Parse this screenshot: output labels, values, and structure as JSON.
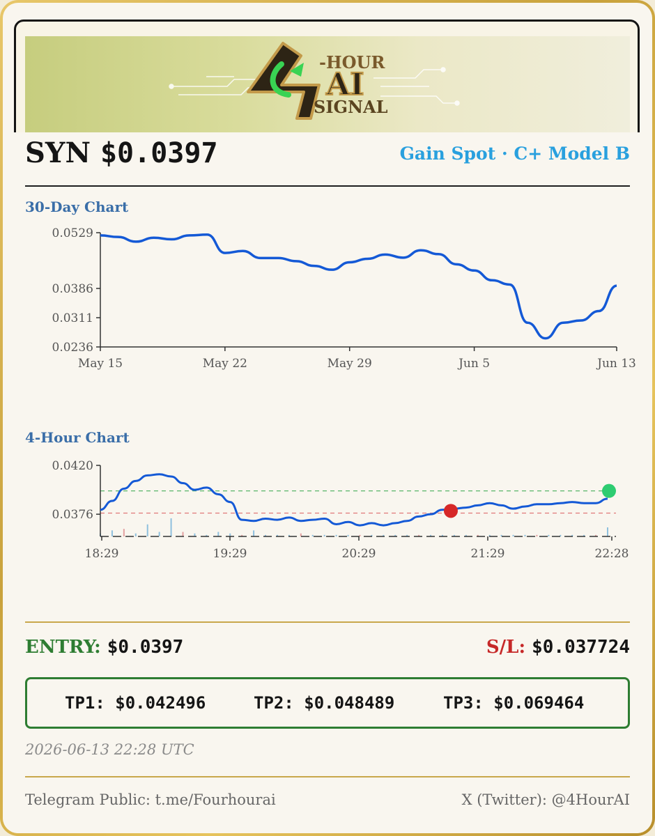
{
  "header": {
    "symbol": "SYN",
    "price": "$0.0397",
    "model": "Gain Spot · C+ Model B"
  },
  "logo": {
    "line1": "-HOUR",
    "line2": "AI",
    "line3": "SIGNAL",
    "numeral": "4"
  },
  "colors": {
    "line": "#1459d6",
    "tp_line": "#5ab56a",
    "sl_line": "#e07878",
    "entry_dot": "#d62828",
    "target_dot": "#2ecc71",
    "gold": "#c9a74b"
  },
  "chart_data": [
    {
      "type": "line",
      "title": "30-Day Chart",
      "x": [
        "May 15",
        "May 16",
        "May 17",
        "May 18",
        "May 19",
        "May 20",
        "May 21",
        "May 22",
        "May 23",
        "May 24",
        "May 25",
        "May 26",
        "May 27",
        "May 28",
        "May 29",
        "May 30",
        "May 31",
        "Jun 1",
        "Jun 2",
        "Jun 3",
        "Jun 4",
        "Jun 5",
        "Jun 6",
        "Jun 7",
        "Jun 8",
        "Jun 9",
        "Jun 10",
        "Jun 11",
        "Jun 12",
        "Jun 13"
      ],
      "y": [
        0.0522,
        0.0518,
        0.0506,
        0.0516,
        0.0512,
        0.0522,
        0.0524,
        0.0477,
        0.0482,
        0.0464,
        0.0464,
        0.0456,
        0.0444,
        0.0434,
        0.0453,
        0.0462,
        0.0473,
        0.0465,
        0.0484,
        0.0474,
        0.0448,
        0.0432,
        0.0407,
        0.0396,
        0.0298,
        0.0258,
        0.0298,
        0.0304,
        0.0328,
        0.0393
      ],
      "ylim": [
        0.0236,
        0.0529
      ],
      "yticks": [
        "0.0529",
        "0.0386",
        "0.0311",
        "0.0236"
      ],
      "xticks": [
        "May 15",
        "May 22",
        "May 29",
        "Jun 5",
        "Jun 13"
      ]
    },
    {
      "type": "line",
      "title": "4-Hour Chart",
      "x_start": "18:29",
      "x_end": "22:28",
      "y": [
        0.038,
        0.0388,
        0.0399,
        0.0406,
        0.0411,
        0.0412,
        0.041,
        0.0404,
        0.0398,
        0.04,
        0.0394,
        0.0387,
        0.0371,
        0.037,
        0.0372,
        0.0371,
        0.0373,
        0.037,
        0.0371,
        0.0372,
        0.0367,
        0.0369,
        0.0366,
        0.0368,
        0.0366,
        0.0368,
        0.037,
        0.0374,
        0.0376,
        0.038,
        0.0381,
        0.0382,
        0.0384,
        0.0386,
        0.0384,
        0.0381,
        0.0383,
        0.0385,
        0.0385,
        0.0386,
        0.0387,
        0.0386,
        0.0386,
        0.039
      ],
      "volume": [
        2,
        4,
        5,
        2,
        8,
        3,
        12,
        3,
        2,
        1,
        3,
        2,
        1,
        4,
        1,
        1,
        1,
        2,
        1,
        1,
        1,
        1,
        1,
        1,
        1,
        1,
        1,
        1,
        1,
        1,
        1,
        1,
        1,
        1,
        1,
        1,
        1,
        1,
        1,
        1,
        1,
        1,
        1,
        6
      ],
      "ylim": [
        0.0356,
        0.042
      ],
      "yticks": [
        "0.0420",
        "0.0376"
      ],
      "xticks": [
        "18:29",
        "19:29",
        "20:29",
        "21:29",
        "22:28"
      ],
      "tp_level": 0.0397,
      "sl_level": 0.0377,
      "entry_point": {
        "index": 29,
        "value": 0.0379
      },
      "target_point": {
        "index": 43,
        "value": 0.0397
      }
    }
  ],
  "levels": {
    "entry_label": "ENTRY:",
    "entry_value": "$0.0397",
    "sl_label": "S/L:",
    "sl_value": "$0.037724"
  },
  "targets": {
    "tp1": "TP1: $0.042496",
    "tp2": "TP2: $0.048489",
    "tp3": "TP3: $0.069464"
  },
  "timestamp": "2026-06-13 22:28 UTC",
  "footer": {
    "telegram": "Telegram Public: t.me/Fourhourai",
    "twitter": "X (Twitter): @4HourAI"
  }
}
